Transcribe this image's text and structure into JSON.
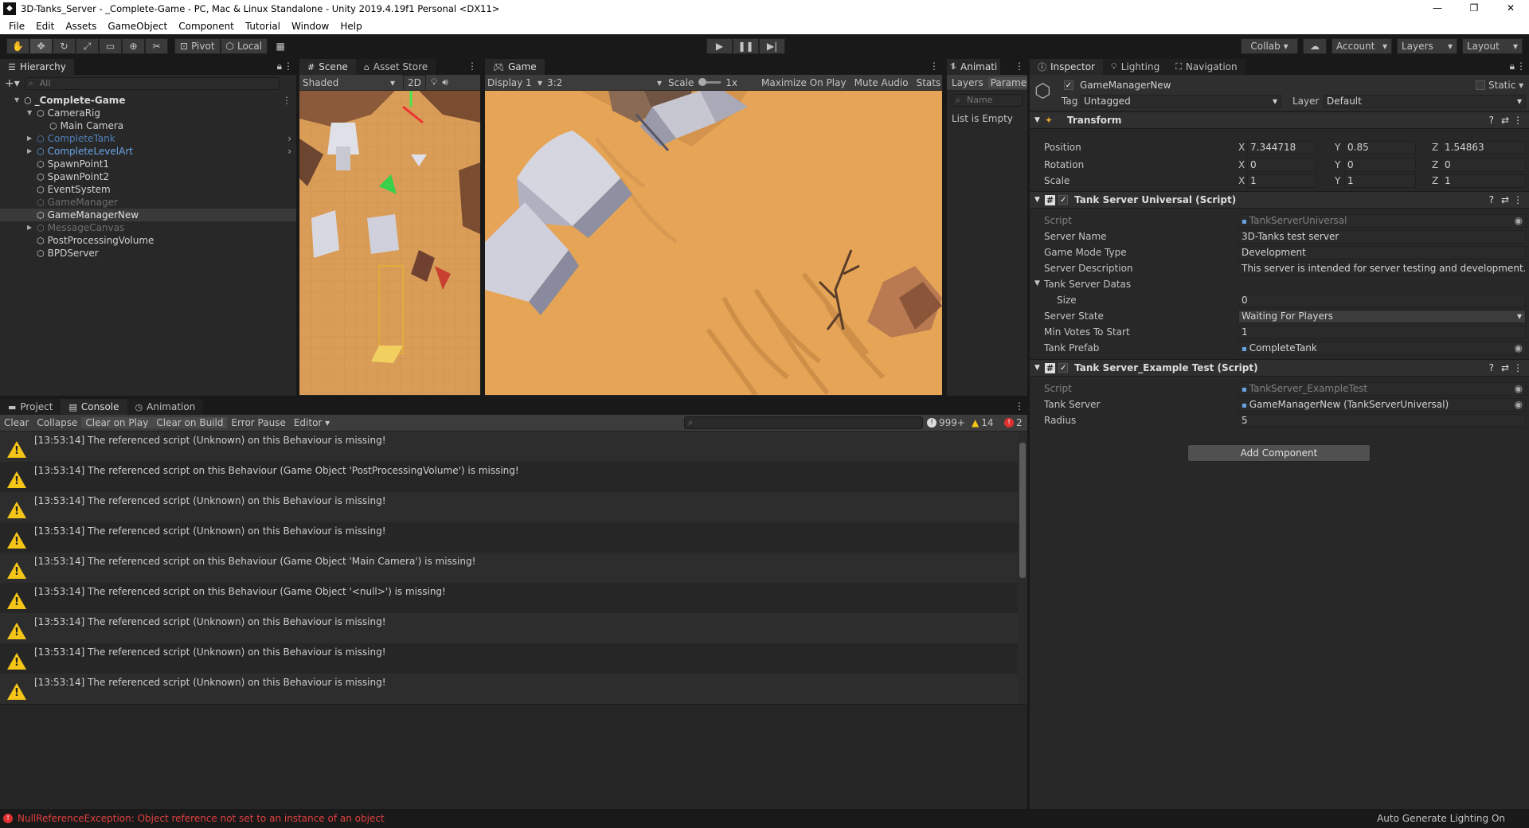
{
  "window": {
    "title": "3D-Tanks_Server - _Complete-Game - PC, Mac & Linux Standalone - Unity 2019.4.19f1 Personal <DX11>",
    "controls": [
      "—",
      "❐",
      "✕"
    ]
  },
  "menu": [
    "File",
    "Edit",
    "Assets",
    "GameObject",
    "Component",
    "Tutorial",
    "Window",
    "Help"
  ],
  "toolbar": {
    "pivot": "Pivot",
    "local": "Local",
    "collab": "Collab ▾",
    "account": "Account",
    "layers": "Layers",
    "layout": "Layout"
  },
  "hierarchy": {
    "tab": "Hierarchy",
    "search_placeholder": "All",
    "items": [
      {
        "label": "_Complete-Game",
        "indent": 0,
        "bold": true,
        "arrow": "▼",
        "color": "#d8d8d8"
      },
      {
        "label": "CameraRig",
        "indent": 1,
        "arrow": "▼",
        "color": "#d0d0d0"
      },
      {
        "label": "Main Camera",
        "indent": 2,
        "arrow": "",
        "color": "#d0d0d0"
      },
      {
        "label": "CompleteTank",
        "indent": 1,
        "arrow": "▶",
        "color": "#4f7fb8"
      },
      {
        "label": "CompleteLevelArt",
        "indent": 1,
        "arrow": "▶",
        "color": "#6aa4e6"
      },
      {
        "label": "SpawnPoint1",
        "indent": 1,
        "arrow": "",
        "color": "#d0d0d0"
      },
      {
        "label": "SpawnPoint2",
        "indent": 1,
        "arrow": "",
        "color": "#d0d0d0"
      },
      {
        "label": "EventSystem",
        "indent": 1,
        "arrow": "",
        "color": "#d0d0d0"
      },
      {
        "label": "GameManager",
        "indent": 1,
        "arrow": "",
        "color": "#6f6f6f"
      },
      {
        "label": "GameManagerNew",
        "indent": 1,
        "arrow": "",
        "color": "#e0e0e0",
        "selected": true
      },
      {
        "label": "MessageCanvas",
        "indent": 1,
        "arrow": "▶",
        "color": "#6f6f6f"
      },
      {
        "label": "PostProcessingVolume",
        "indent": 1,
        "arrow": "",
        "color": "#d0d0d0"
      },
      {
        "label": "BPDServer",
        "indent": 1,
        "arrow": "",
        "color": "#d0d0d0"
      }
    ]
  },
  "scene": {
    "tabs": [
      "Scene",
      "Asset Store"
    ],
    "shading": "Shaded",
    "mode_2d": "2D"
  },
  "game": {
    "tab": "Game",
    "display": "Display 1",
    "aspect": "3:2",
    "scale_label": "Scale",
    "scale_value": "1x",
    "maximize": "Maximize On Play",
    "mute": "Mute Audio",
    "stats": "Stats"
  },
  "animator": {
    "tab": "Animati",
    "layers": "Layers",
    "params": "Parame",
    "search_placeholder": "Name",
    "empty": "List is Empty"
  },
  "console": {
    "tabs": [
      "Project",
      "Console",
      "Animation"
    ],
    "buttons": [
      "Clear",
      "Collapse",
      "Clear on Play",
      "Clear on Build",
      "Error Pause",
      "Editor ▾"
    ],
    "log_count": "999+",
    "warn_count": "14",
    "error_count": "2",
    "messages": [
      "[13:53:14] The referenced script (Unknown) on this Behaviour is missing!",
      "[13:53:14] The referenced script on this Behaviour (Game Object 'PostProcessingVolume') is missing!",
      "[13:53:14] The referenced script (Unknown) on this Behaviour is missing!",
      "[13:53:14] The referenced script (Unknown) on this Behaviour is missing!",
      "[13:53:14] The referenced script on this Behaviour (Game Object 'Main Camera') is missing!",
      "[13:53:14] The referenced script on this Behaviour (Game Object '<null>') is missing!",
      "[13:53:14] The referenced script (Unknown) on this Behaviour is missing!",
      "[13:53:14] The referenced script (Unknown) on this Behaviour is missing!",
      "[13:53:14] The referenced script (Unknown) on this Behaviour is missing!"
    ]
  },
  "inspector": {
    "tabs": [
      "Inspector",
      "Lighting",
      "Navigation"
    ],
    "object_name": "GameManagerNew",
    "static": "Static",
    "tag_label": "Tag",
    "tag_value": "Untagged",
    "layer_label": "Layer",
    "layer_value": "Default",
    "transform": {
      "title": "Transform",
      "position": {
        "label": "Position",
        "x": "7.344718",
        "y": "0.85",
        "z": "1.54863"
      },
      "rotation": {
        "label": "Rotation",
        "x": "0",
        "y": "0",
        "z": "0"
      },
      "scale": {
        "label": "Scale",
        "x": "1",
        "y": "1",
        "z": "1"
      }
    },
    "tank_server": {
      "title": "Tank Server Universal (Script)",
      "fields": [
        {
          "label": "Script",
          "value": "TankServerUniversal",
          "dim": true
        },
        {
          "label": "Server Name",
          "value": "3D-Tanks test server"
        },
        {
          "label": "Game Mode Type",
          "value": "Development"
        },
        {
          "label": "Server Description",
          "value": "This server is intended for server testing and development. You"
        },
        {
          "label": "Tank Server Datas",
          "value": ""
        },
        {
          "label": "Size",
          "value": "0"
        },
        {
          "label": "Server State",
          "value": "Waiting For Players"
        },
        {
          "label": "Min Votes To Start",
          "value": "1"
        },
        {
          "label": "Tank Prefab",
          "value": "CompleteTank"
        }
      ]
    },
    "example_test": {
      "title": "Tank Server_Example Test (Script)",
      "fields": [
        {
          "label": "Script",
          "value": "TankServer_ExampleTest"
        },
        {
          "label": "Tank Server",
          "value": "GameManagerNew (TankServerUniversal)"
        },
        {
          "label": "Radius",
          "value": "5"
        }
      ]
    },
    "add_component": "Add Component"
  },
  "status": {
    "error": "NullReferenceException: Object reference not set to an instance of an object",
    "right": "Auto Generate Lighting On"
  }
}
